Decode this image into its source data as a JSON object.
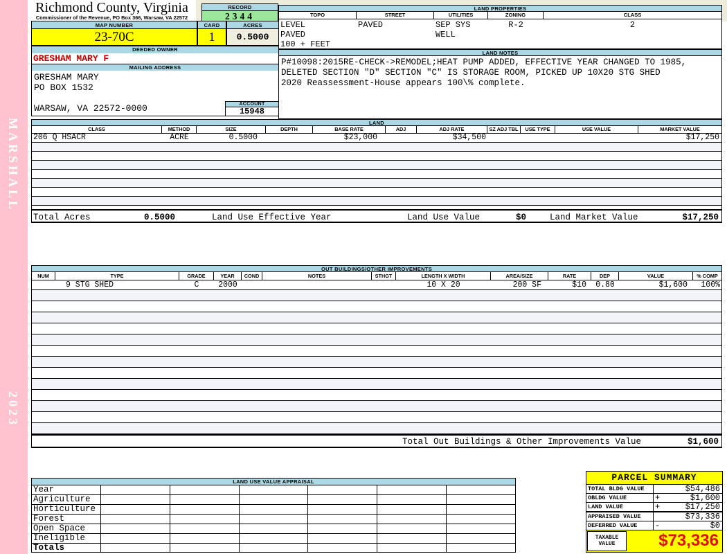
{
  "sidebar": {
    "name": "MARSHALL",
    "year": "2023"
  },
  "header": {
    "title": "Richmond County, Virginia",
    "subtitle": "Commissioner of the Revenue, PO Box 366, Warsaw, VA 22572"
  },
  "record": {
    "label": "RECORD",
    "value": "2344"
  },
  "identity": {
    "map_number_label": "MAP NUMBER",
    "map_number": "23-70C",
    "card_label": "CARD",
    "card": "1",
    "acres_label": "ACRES",
    "acres": "0.5000",
    "deeded_owner_label": "DEEDED OWNER",
    "deeded_owner": "GRESHAM MARY F",
    "mailing_address_label": "MAILING ADDRESS",
    "mailing_address": [
      "GRESHAM MARY",
      "PO BOX 1532",
      "",
      "WARSAW, VA 22572-0000"
    ],
    "account_label": "ACCOUNT",
    "account": "15948"
  },
  "land_properties": {
    "title": "LAND PROPERTIES",
    "headers": [
      "TOPO",
      "STREET",
      "UTILITIES",
      "ZONING",
      "CLASS"
    ],
    "topo": [
      "LEVEL",
      "PAVED",
      "100 + FEET"
    ],
    "street": [
      "PAVED"
    ],
    "utilities": [
      "SEP SYS",
      "WELL"
    ],
    "zoning": [
      "R-2"
    ],
    "class": [
      "2"
    ]
  },
  "land_notes": {
    "title": "LAND NOTES",
    "lines": [
      "P#10098:2015RE-CHECK->REMODEL;HEAT PUMP ADDED, EFFECTIVE YEAR CHANGED TO 1985,",
      "DELETED SECTION \"D\" SECTION \"C\" IS STORAGE ROOM, PICKED UP 10X20 STG SHED",
      "2020 Reassessment-House appears 100\\% complete."
    ]
  },
  "land_table": {
    "title": "LAND",
    "headers": [
      "CLASS",
      "METHOD",
      "SIZE",
      "DEPTH",
      "BASE RATE",
      "ADJ",
      "ADJ RATE",
      "SZ ADJ TBL",
      "USE TYPE",
      "USE VALUE",
      "MARKET VALUE"
    ],
    "row": {
      "class": "206 Q HSACR",
      "method": "ACRE",
      "size": "0.5000",
      "depth": "",
      "base_rate": "$23,000",
      "adj": "",
      "adj_rate": "$34,500",
      "sz_adj_tbl": "",
      "use_type": "",
      "use_value": "",
      "market_value": "$17,250"
    },
    "totals": {
      "total_acres_label": "Total Acres",
      "total_acres": "0.5000",
      "effective_year_label": "Land Use Effective Year",
      "use_value_label": "Land Use Value",
      "use_value": "$0",
      "market_value_label": "Land Market Value",
      "market_value": "$17,250"
    }
  },
  "out_buildings": {
    "title": "OUT BUILDINGS/OTHER IMPROVEMENTS",
    "headers": [
      "NUM",
      "TYPE",
      "GRADE",
      "YEAR",
      "COND",
      "NOTES",
      "STHGT",
      "LENGTH X WIDTH",
      "AREA/SIZE",
      "RATE",
      "DEP",
      "VALUE",
      "% COMP"
    ],
    "row": {
      "num": "",
      "type": "9 STG SHED",
      "grade": "C",
      "year": "2000",
      "cond": "",
      "notes": "",
      "sthgt": "",
      "length_x_width": "10 X 20",
      "area_size": "200 SF",
      "rate": "$10",
      "dep": "0.80",
      "value": "$1,600",
      "pct_comp": "100%"
    },
    "total_label": "Total Out Buildings & Other Improvements Value",
    "total_value": "$1,600"
  },
  "land_use_appraisal": {
    "title": "LAND USE VALUE APPRAISAL",
    "rows": [
      "Year",
      "Agriculture",
      "Horticulture",
      "Forest",
      "Open Space",
      "Ineligible",
      "Totals"
    ]
  },
  "parcel_summary": {
    "title": "PARCEL SUMMARY",
    "rows": [
      {
        "label": "TOTAL BLDG VALUE",
        "op": "",
        "value": "$54,486"
      },
      {
        "label": "OBLDG VALUE",
        "op": "+",
        "value": "$1,600"
      },
      {
        "label": "LAND VALUE",
        "op": "+",
        "value": "$17,250"
      },
      {
        "label": "APPRAISED VALUE",
        "op": "",
        "value": "$73,336"
      },
      {
        "label": "DEFERRED VALUE",
        "op": "-",
        "value": "$0"
      }
    ],
    "taxable_label_line1": "TAXABLE",
    "taxable_label_line2": "VALUE",
    "taxable_value": "$73,336"
  },
  "colors": {
    "margin_pink": "#FFC2CE",
    "header_blue": "#ACD8E6",
    "record_green": "#9CE79C",
    "highlight_yellow": "#FFFF00",
    "acres_cream": "#EFEEDF",
    "owner_red": "#C00000",
    "taxable_red": "#E01010"
  }
}
